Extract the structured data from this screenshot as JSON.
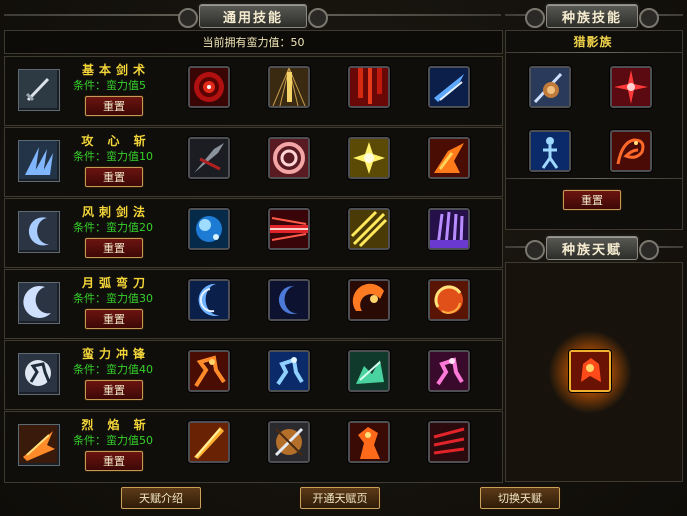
{
  "tabs": {
    "general_skills": "通用技能",
    "race_skills": "种族技能",
    "race_talent": "种族天赋"
  },
  "header": {
    "current_value": "当前拥有蛮力值：50"
  },
  "rows": [
    {
      "name": "基本剑术",
      "condition": "条件：蛮力值5",
      "reset": "重置",
      "icon": "sword-icon",
      "skills": [
        "red-target-icon",
        "golden-blade-icon",
        "blood-drip-icon",
        "blue-slash-icon"
      ]
    },
    {
      "name": "攻 心 斩",
      "condition": "条件：蛮力值10",
      "reset": "重置",
      "icon": "claw-slash-icon",
      "skills": [
        "dark-spike-icon",
        "pink-spiral-icon",
        "yellow-burst-icon",
        "fire-strike-icon"
      ]
    },
    {
      "name": "风刺剑法",
      "condition": "条件：蛮力值20",
      "reset": "重置",
      "icon": "wind-crescent-icon",
      "skills": [
        "water-orb-icon",
        "red-beam-icon",
        "yellow-ray-icon",
        "purple-rays-icon"
      ]
    },
    {
      "name": "月弧弯刀",
      "condition": "条件：蛮力值30",
      "reset": "重置",
      "icon": "moon-arc-icon",
      "skills": [
        "blue-crescent-icon",
        "dark-moon-icon",
        "fire-arc-icon",
        "flame-swirl-icon"
      ]
    },
    {
      "name": "蛮力冲锋",
      "condition": "条件：蛮力值40",
      "reset": "重置",
      "icon": "charge-icon",
      "skills": [
        "fire-warrior-icon",
        "blue-runner-icon",
        "green-beast-icon",
        "purple-rush-icon"
      ]
    },
    {
      "name": "烈 焰 斩",
      "condition": "条件：蛮力值50",
      "reset": "重置",
      "icon": "flame-slash-icon",
      "skills": [
        "fire-blade-icon",
        "crossed-sword-icon",
        "flame-warrior-icon",
        "blood-claw-icon"
      ]
    }
  ],
  "race": {
    "name": "猎影族",
    "skills": [
      "hunter-fist-icon",
      "red-star-icon",
      "blue-figure-icon",
      "red-dragon-icon"
    ],
    "reset": "重置",
    "talent_icon": "flame-sigil-icon"
  },
  "bottom": {
    "talent_intro": "天赋介绍",
    "open_talent_page": "开通天赋页",
    "switch_talent": "切换天赋"
  },
  "colors": {
    "title_gold": "#f3d53a",
    "condition_green": "#35d12a",
    "button_red": "#6b1410"
  }
}
